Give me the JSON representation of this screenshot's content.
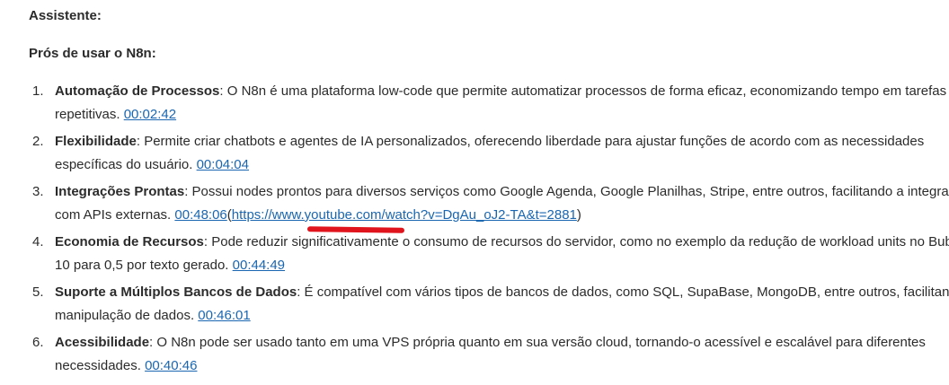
{
  "speaker": "Assistente:",
  "heading": "Prós de usar o N8n:",
  "items": [
    {
      "number": "1.",
      "title": "Automação de Processos",
      "line1": ": O N8n é uma plataforma low-code que permite automatizar processos de forma eficaz, economizando tempo em tarefas",
      "line2": "repetitivas. ",
      "timestamp": "00:02:42"
    },
    {
      "number": "2.",
      "title": "Flexibilidade",
      "line1": ": Permite criar chatbots e agentes de IA personalizados, oferecendo liberdade para ajustar funções de acordo com as necessidades",
      "line2": "específicas do usuário. ",
      "timestamp": "00:04:04"
    },
    {
      "number": "3.",
      "title": "Integrações Prontas",
      "line1": ": Possui nodes prontos para diversos serviços como Google Agenda, Google Planilhas, Stripe, entre outros, facilitando a integração",
      "line2": "com APIs externas. ",
      "timestamp": "00:48:06",
      "url_open": "(",
      "url": "https://www.youtube.com/watch?v=DgAu_oJ2-TA&t=2881",
      "url_close": ")"
    },
    {
      "number": "4.",
      "title": "Economia de Recursos",
      "line1": ": Pode reduzir significativamente o consumo de recursos do servidor, como no exemplo da redução de workload units no Bubble de",
      "line2": "10 para 0,5 por texto gerado. ",
      "timestamp": "00:44:49"
    },
    {
      "number": "5.",
      "title": "Suporte a Múltiplos Bancos de Dados",
      "line1": ": É compatível com vários tipos de bancos de dados, como SQL, SupaBase, MongoDB, entre outros, facilitando a",
      "line2": "manipulação de dados. ",
      "timestamp": "00:46:01"
    },
    {
      "number": "6.",
      "title": "Acessibilidade",
      "line1": ": O N8n pode ser usado tanto em uma VPS própria quanto em sua versão cloud, tornando-o acessível e escalável para diferentes",
      "line2": "necessidades. ",
      "timestamp": "00:40:46"
    }
  ],
  "colors": {
    "link": "#1a66b0",
    "annotation": "#e0141c",
    "text": "#2b2b2b"
  }
}
